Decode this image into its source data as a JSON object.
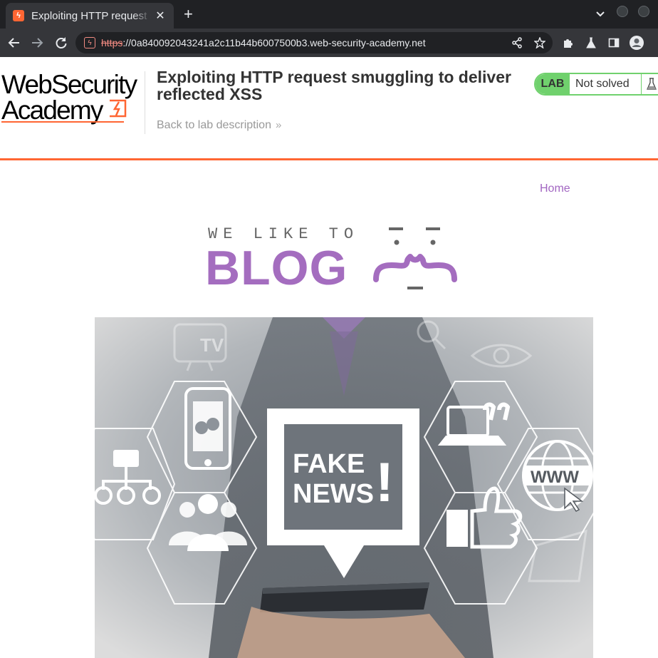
{
  "browser": {
    "tab_title": "Exploiting HTTP request smuggling to deliver reflected XSS",
    "tab_favicon_glyph": "ϟ",
    "tab_close": "✕",
    "new_tab": "+",
    "tabs_menu": "⌄",
    "url_scheme": "https",
    "url_rest": "://0a840092043241a2c11b44b6007500b3.web-security-academy.net",
    "nav_icons": [
      "back-arrow-icon",
      "forward-arrow-icon",
      "reload-icon"
    ],
    "omnibox_icons": [
      "share-icon",
      "bookmark-star-icon"
    ],
    "toolbar_icons": [
      "extensions-puzzle-icon",
      "labs-flask-icon",
      "side-panel-icon",
      "profile-avatar-icon"
    ]
  },
  "lab_header": {
    "logo_line1": "WebSecurity",
    "logo_line2": "Academy",
    "title": "Exploiting HTTP request smuggling to deliver reflected XSS",
    "back_link": "Back to lab description",
    "back_arrow": "»",
    "status_badge": "LAB",
    "status_text": "Not solved",
    "colors": {
      "accent": "#ff6633",
      "status_green": "#70d16d"
    }
  },
  "blog": {
    "nav_home": "Home",
    "tagline": "WE LIKE TO",
    "wordmark": "BLOG",
    "brand_color": "#a46dbf",
    "hero_image": {
      "headline_line1": "FAKE",
      "headline_line2": "NEWS",
      "headline_mark": "!",
      "tv_label": "TV",
      "www_label": "WWW"
    }
  }
}
